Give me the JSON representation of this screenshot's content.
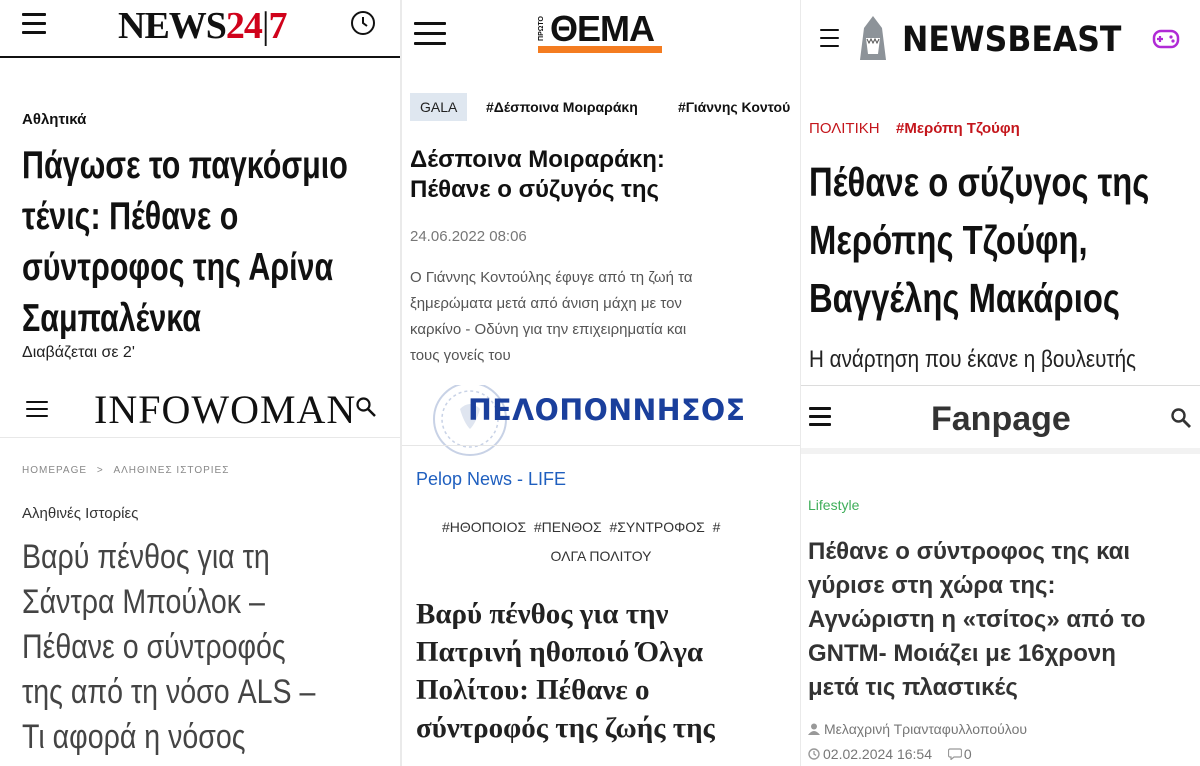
{
  "p1": {
    "logo_news": "NEWS",
    "logo_num": "24",
    "logo_sep": "|",
    "logo_seven": "7",
    "category": "Αθλητικά",
    "title_lines": [
      "Πάγωσε το παγκόσμιο",
      "τένις: Πέθανε ο",
      "σύντροφος της Αρίνα",
      "Σαμπαλένκα"
    ],
    "read_time": "Διαβάζεται σε 2'"
  },
  "p2": {
    "logo": "ΘΕΜΑ",
    "logo_small": "ΠΡΩΤΟ",
    "tag_box": "GALA",
    "tags": [
      "#Δέσποινα Μοιραράκη",
      "#Γιάννης Κοντού"
    ],
    "title_lines": [
      "Δέσποινα Μοιραράκη:",
      "Πέθανε ο σύζυγός της"
    ],
    "date": "24.06.2022 08:06",
    "summary_lines": [
      "Ο Γιάννης Κοντούλης έφυγε από τη ζωή τα",
      "ξημερώματα μετά από άνιση μάχη με τον",
      "καρκίνο - Οδύνη για την επιχειρηματία και",
      "τους γονείς του"
    ]
  },
  "p3": {
    "logo": "NEWSBEAST",
    "category": "ΠΟΛΙΤΙΚΗ",
    "tag": "#Μερόπη Τζούφη",
    "title_lines": [
      "Πέθανε ο σύζυγος της",
      "Μερόπης Τζούφη,",
      "Βαγγέλης Μακάριος"
    ],
    "subtitle": "Η ανάρτηση που έκανε η βουλευτής"
  },
  "p4": {
    "logo": "INFOWOMAN",
    "breadcrumb_home": "HOMEPAGE",
    "breadcrumb_sep": ">",
    "breadcrumb_section": "ΑΛΗΘΙΝΕΣ ΙΣΤΟΡΙΕΣ",
    "category": "Αληθινές Ιστορίες",
    "title_lines": [
      "Βαρύ πένθος για τη",
      "Σάντρα Μπούλοκ –",
      "Πέθανε ο σύντροφός",
      "της από τη νόσο ALS –",
      "Τι αφορά η νόσος"
    ]
  },
  "p5": {
    "logo": "ΠΕΛΟΠΟΝΝΗΣΟΣ",
    "section": "Pelop News - LIFE",
    "tags_line1": "#ΗΘΟΠΟΙΟΣ  #ΠΕΝΘΟΣ  #ΣΥΝΤΡΟΦΟΣ  #",
    "tags_line2": "ΟΛΓΑ ΠΟΛΙΤΟΥ",
    "title_lines": [
      "Βαρύ πένθος για την",
      "Πατρινή ηθοποιό Όλγα",
      "Πολίτου: Πέθανε ο",
      "σύντροφός της ζωής της"
    ]
  },
  "p6": {
    "logo": "Fanpage",
    "category": "Lifestyle",
    "title_lines": [
      "Πέθανε ο σύντροφος της και",
      "γύρισε στη χώρα της:",
      "Αγνώριστη η «τσίτος» από το",
      "GNTM- Μοιάζει με 16χρονη",
      "μετά τις πλαστικές"
    ],
    "author": "Μελαχρινή Τριανταφυλλοπούλου",
    "date": "02.02.2024 16:54",
    "comments": "0"
  },
  "colors": {
    "news247_red": "#d0021b",
    "protothema_orange": "#f47c20",
    "newsbeast_red": "#c4161c",
    "pelop_blue": "#1a3f9c",
    "pelop_link": "#1f5fbf",
    "newsbeast_purple": "#b02ad6",
    "fanpage_green": "#3fae5a"
  }
}
